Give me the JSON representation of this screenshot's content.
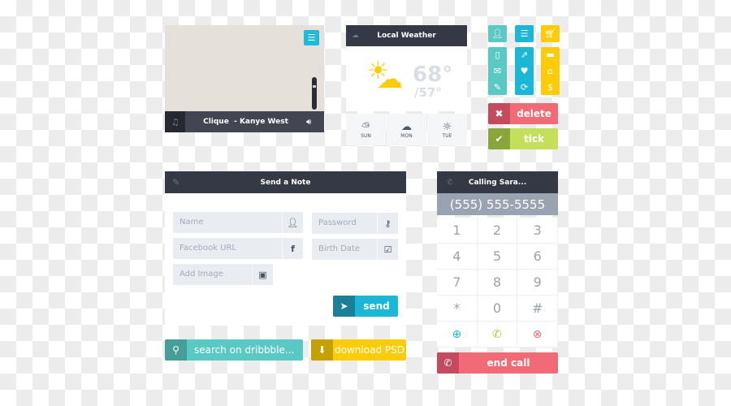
{
  "player": {
    "track": "Clique  - Kanye West",
    "icons": [
      "music-note-icon",
      "list-icon",
      "volume-icon"
    ],
    "volume": 0.75
  },
  "weather": {
    "title": "Local Weather",
    "high": "68°",
    "low": "/57°",
    "forecast": [
      {
        "day": "SUN",
        "icon": "partly-cloudy-icon"
      },
      {
        "day": "MON",
        "icon": "rain-cloud-icon"
      },
      {
        "day": "TUE",
        "icon": "sun-icon"
      }
    ]
  },
  "icon_columns": [
    {
      "color": "#5ac8c3",
      "top": "user-icon",
      "items": [
        "phone-icon",
        "mail-icon",
        "pencil-icon"
      ]
    },
    {
      "color": "#1cb6d6",
      "top": "list-icon",
      "items": [
        "share-icon",
        "heart-icon",
        "refresh-icon"
      ]
    },
    {
      "color": "#fdcc09",
      "top": "cart-icon",
      "items": [
        "credit-card-icon",
        "tag-icon",
        "dollar-icon"
      ]
    }
  ],
  "actions": {
    "delete": "delete",
    "tick": "tick"
  },
  "note": {
    "title": "Send a Note",
    "fields": {
      "name": "Name",
      "password": "Password",
      "facebook": "Facebook URL",
      "birth": "Birth Date",
      "image": "Add Image"
    },
    "send": "send"
  },
  "search": {
    "placeholder": "search on dribbble..."
  },
  "download": {
    "label": "download PSD"
  },
  "dialer": {
    "title": "Calling Sara...",
    "number": "(555) 555-5555",
    "keys": [
      "1",
      "2",
      "3",
      "4",
      "5",
      "6",
      "7",
      "8",
      "9",
      "*",
      "0",
      "#"
    ],
    "end": "end call"
  },
  "colors": {
    "teal": "#5ac8c3",
    "blue": "#1cb6d6",
    "yellow": "#fdcc09",
    "red": "#f06b75",
    "green": "#c4df5a",
    "dark": "#343945"
  }
}
